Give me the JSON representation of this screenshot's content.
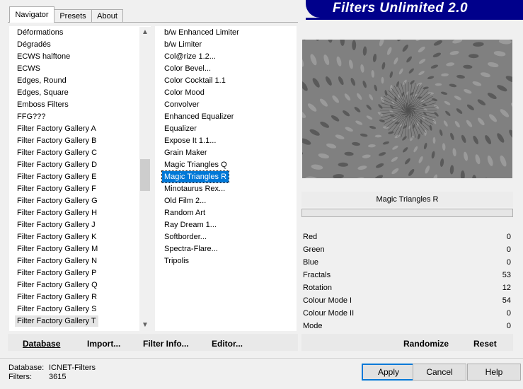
{
  "tabs": [
    "Navigator",
    "Presets",
    "About"
  ],
  "banner": "Filters Unlimited 2.0",
  "categories": [
    "Déformations",
    "Dégradés",
    "ECWS halftone",
    "ECWS",
    "Edges, Round",
    "Edges, Square",
    "Emboss Filters",
    "FFG???",
    "Filter Factory Gallery A",
    "Filter Factory Gallery B",
    "Filter Factory Gallery C",
    "Filter Factory Gallery D",
    "Filter Factory Gallery E",
    "Filter Factory Gallery F",
    "Filter Factory Gallery G",
    "Filter Factory Gallery H",
    "Filter Factory Gallery J",
    "Filter Factory Gallery K",
    "Filter Factory Gallery M",
    "Filter Factory Gallery N",
    "Filter Factory Gallery P",
    "Filter Factory Gallery Q",
    "Filter Factory Gallery R",
    "Filter Factory Gallery S",
    "Filter Factory Gallery T"
  ],
  "selected_category": "Filter Factory Gallery T",
  "filters": [
    "b/w Enhanced Limiter",
    "b/w Limiter",
    "Col@rize 1.2...",
    "Color Bevel...",
    "Color Cocktail 1.1",
    "Color Mood",
    "Convolver",
    "Enhanced Equalizer",
    "Equalizer",
    "Expose It 1.1...",
    "Grain Maker",
    "Magic Triangles Q",
    "Magic Triangles R",
    "Minotaurus Rex...",
    "Old Film 2...",
    "Random Art",
    "Ray Dream 1...",
    "Softborder...",
    "Spectra-Flare...",
    "Tripolis"
  ],
  "selected_filter": "Magic Triangles R",
  "filter_name": "Magic Triangles R",
  "params": [
    {
      "label": "Red",
      "value": "0"
    },
    {
      "label": "Green",
      "value": "0"
    },
    {
      "label": "Blue",
      "value": "0"
    },
    {
      "label": "Fractals",
      "value": "53"
    },
    {
      "label": "Rotation",
      "value": "12"
    },
    {
      "label": "Colour Mode I",
      "value": "54"
    },
    {
      "label": "Colour Mode II",
      "value": "0"
    },
    {
      "label": "Mode",
      "value": "0"
    }
  ],
  "toolbar": {
    "database": "Database",
    "import": "Import...",
    "filter_info": "Filter Info...",
    "editor": "Editor..."
  },
  "param_buttons": {
    "randomize": "Randomize",
    "reset": "Reset"
  },
  "status": {
    "db_label": "Database:",
    "db_value": "ICNET-Filters",
    "filters_label": "Filters:",
    "filters_value": "3615"
  },
  "dialog_buttons": {
    "apply": "Apply",
    "cancel": "Cancel",
    "help": "Help"
  }
}
